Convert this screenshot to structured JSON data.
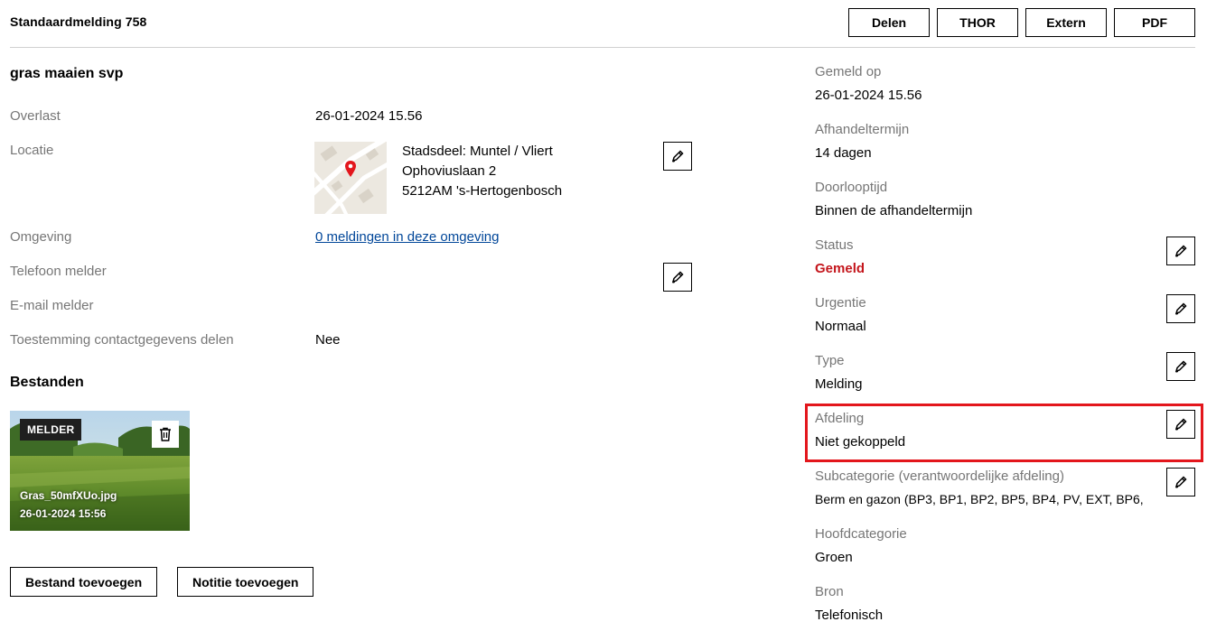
{
  "header": {
    "title": "Standaardmelding 758",
    "buttons": [
      "Delen",
      "THOR",
      "Extern",
      "PDF"
    ]
  },
  "main": {
    "title": "gras maaien svp",
    "fields": {
      "overlast": {
        "label": "Overlast",
        "value": "26-01-2024 15.56"
      },
      "locatie": {
        "label": "Locatie",
        "lines": [
          "Stadsdeel: Muntel / Vliert",
          "Ophoviuslaan 2",
          "5212AM 's-Hertogenbosch"
        ]
      },
      "omgeving": {
        "label": "Omgeving",
        "link": "0 meldingen in deze omgeving"
      },
      "telefoon": {
        "label": "Telefoon melder"
      },
      "email": {
        "label": "E-mail melder"
      },
      "toestemming": {
        "label": "Toestemming contactgegevens delen",
        "value": "Nee"
      }
    },
    "files_heading": "Bestanden",
    "file": {
      "badge": "MELDER",
      "name": "Gras_50mfXUo.jpg",
      "date": "26-01-2024 15:56"
    },
    "add_file_label": "Bestand toevoegen",
    "add_note_label": "Notitie toevoegen"
  },
  "side": {
    "gemeld_op": {
      "label": "Gemeld op",
      "value": "26-01-2024 15.56"
    },
    "afhandeltermijn": {
      "label": "Afhandeltermijn",
      "value": "14 dagen"
    },
    "doorlooptijd": {
      "label": "Doorlooptijd",
      "value": "Binnen de afhandeltermijn"
    },
    "status": {
      "label": "Status",
      "value": "Gemeld"
    },
    "urgentie": {
      "label": "Urgentie",
      "value": "Normaal"
    },
    "type": {
      "label": "Type",
      "value": "Melding"
    },
    "afdeling": {
      "label": "Afdeling",
      "value": "Niet gekoppeld"
    },
    "subcategorie": {
      "label": "Subcategorie (verantwoordelijke afdeling)",
      "value": "Berm en gazon (BP3, BP1, BP2, BP5, BP4, PV, EXT, BP6,"
    },
    "hoofdcategorie": {
      "label": "Hoofdcategorie",
      "value": "Groen"
    },
    "bron": {
      "label": "Bron",
      "value": "Telefonisch"
    }
  },
  "colors": {
    "status_red": "#c4161c",
    "highlight": "#e3161c",
    "link": "#004699"
  }
}
